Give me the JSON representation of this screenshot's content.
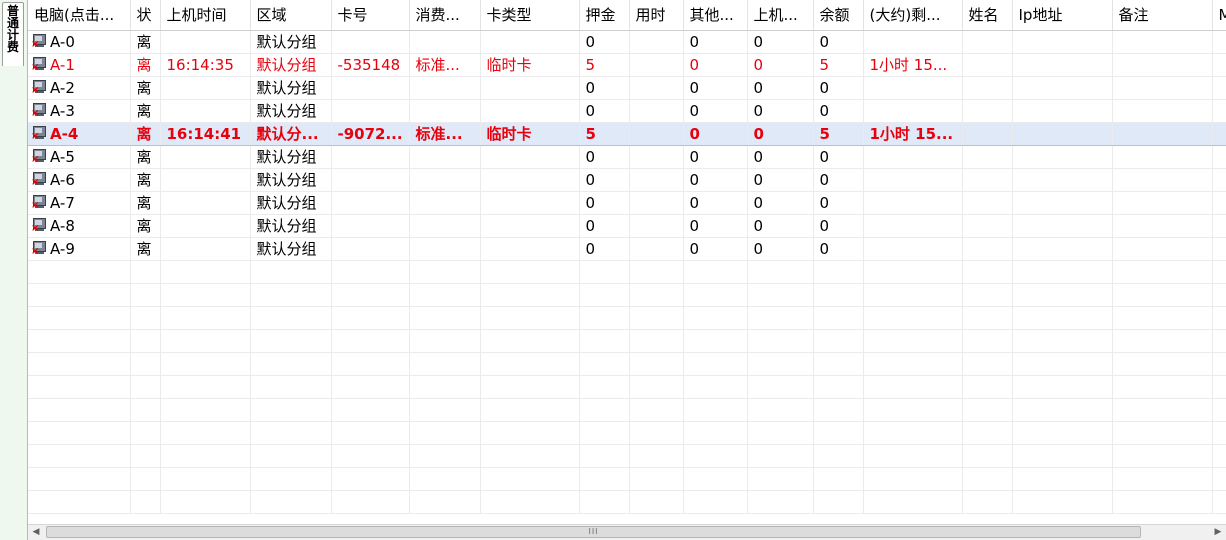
{
  "tab": {
    "label_chars": [
      "普",
      "通",
      "计",
      "费"
    ]
  },
  "columns": [
    "电脑(点击...",
    "状",
    "上机时间",
    "区域",
    "卡号",
    "消费...",
    "卡类型",
    "押金",
    "用时",
    "其他...",
    "上机...",
    "余额",
    "(大约)剩...",
    "姓名",
    "Ip地址",
    "备注",
    "M"
  ],
  "rows": [
    {
      "style": "normal",
      "cells": [
        "A-0",
        "离",
        "",
        "默认分组",
        "",
        "",
        "",
        "0",
        "",
        "0",
        "0",
        "0",
        "",
        "",
        "",
        "",
        ""
      ]
    },
    {
      "style": "red",
      "cells": [
        "A-1",
        "离",
        "16:14:35",
        "默认分组",
        "-535148",
        "标准...",
        "临时卡",
        "5",
        "",
        "0",
        "0",
        "5",
        "1小时 15...",
        "",
        "",
        "",
        ""
      ]
    },
    {
      "style": "normal",
      "cells": [
        "A-2",
        "离",
        "",
        "默认分组",
        "",
        "",
        "",
        "0",
        "",
        "0",
        "0",
        "0",
        "",
        "",
        "",
        "",
        ""
      ]
    },
    {
      "style": "normal",
      "cells": [
        "A-3",
        "离",
        "",
        "默认分组",
        "",
        "",
        "",
        "0",
        "",
        "0",
        "0",
        "0",
        "",
        "",
        "",
        "",
        ""
      ]
    },
    {
      "style": "selected",
      "cells": [
        "A-4",
        "离",
        "16:14:41",
        "默认分...",
        "-9072...",
        "标准...",
        "临时卡",
        "5",
        "",
        "0",
        "0",
        "5",
        "1小时 15...",
        "",
        "",
        "",
        ""
      ]
    },
    {
      "style": "normal",
      "cells": [
        "A-5",
        "离",
        "",
        "默认分组",
        "",
        "",
        "",
        "0",
        "",
        "0",
        "0",
        "0",
        "",
        "",
        "",
        "",
        ""
      ]
    },
    {
      "style": "normal",
      "cells": [
        "A-6",
        "离",
        "",
        "默认分组",
        "",
        "",
        "",
        "0",
        "",
        "0",
        "0",
        "0",
        "",
        "",
        "",
        "",
        ""
      ]
    },
    {
      "style": "normal",
      "cells": [
        "A-7",
        "离",
        "",
        "默认分组",
        "",
        "",
        "",
        "0",
        "",
        "0",
        "0",
        "0",
        "",
        "",
        "",
        "",
        ""
      ]
    },
    {
      "style": "normal",
      "cells": [
        "A-8",
        "离",
        "",
        "默认分组",
        "",
        "",
        "",
        "0",
        "",
        "0",
        "0",
        "0",
        "",
        "",
        "",
        "",
        ""
      ]
    },
    {
      "style": "normal",
      "cells": [
        "A-9",
        "离",
        "",
        "默认分组",
        "",
        "",
        "",
        "0",
        "",
        "0",
        "0",
        "0",
        "",
        "",
        "",
        "",
        ""
      ]
    }
  ],
  "empty_row_count": 11,
  "scrollbar": {
    "left_arrow": "◀",
    "right_arrow": "▶",
    "grip": "III"
  },
  "colors": {
    "red_text": "#e8000d",
    "selected_bg": "#dfe9f7",
    "tab_strip_bg": "#eef8ee"
  }
}
